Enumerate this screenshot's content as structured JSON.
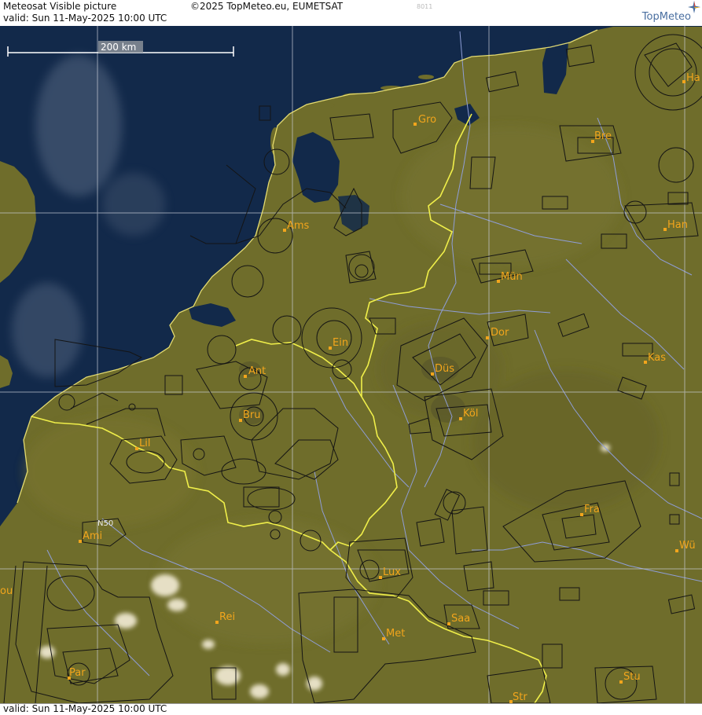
{
  "header": {
    "product": "Meteosat Visible picture",
    "copyright": "©2025 TopMeteo.eu, EUMETSAT",
    "valid_top": "valid:  Sun  11-May-2025  10:00 UTC",
    "code": "8011",
    "logo_text": "TopMeteo"
  },
  "footer": {
    "valid_bottom": "valid:  Sun  11-May-2025  10:00 UTC"
  },
  "map": {
    "scale_label": "200 km",
    "lat_label": "N50",
    "colors": {
      "sea": "#12294a",
      "land": "#6f6d2b",
      "border": "#f0ef4a",
      "grid": "#c7ccd6",
      "airspace": "#141414",
      "city": "#f2a51c",
      "river": "#8f9ed8"
    },
    "cities": [
      {
        "name": "Gro"
      },
      {
        "name": "Bre"
      },
      {
        "name": "Ha"
      },
      {
        "name": "Han"
      },
      {
        "name": "Ams"
      },
      {
        "name": "Mün"
      },
      {
        "name": "Dor"
      },
      {
        "name": "Kas"
      },
      {
        "name": "Ein"
      },
      {
        "name": "Ant"
      },
      {
        "name": "Düs"
      },
      {
        "name": "Bru"
      },
      {
        "name": "Köl"
      },
      {
        "name": "Lil"
      },
      {
        "name": "Fra"
      },
      {
        "name": "Ami"
      },
      {
        "name": "Wü"
      },
      {
        "name": "Lux"
      },
      {
        "name": "Rei"
      },
      {
        "name": "Saa"
      },
      {
        "name": "Met"
      },
      {
        "name": "Par"
      },
      {
        "name": "Stu"
      },
      {
        "name": "Str"
      },
      {
        "name": "ou"
      }
    ]
  }
}
